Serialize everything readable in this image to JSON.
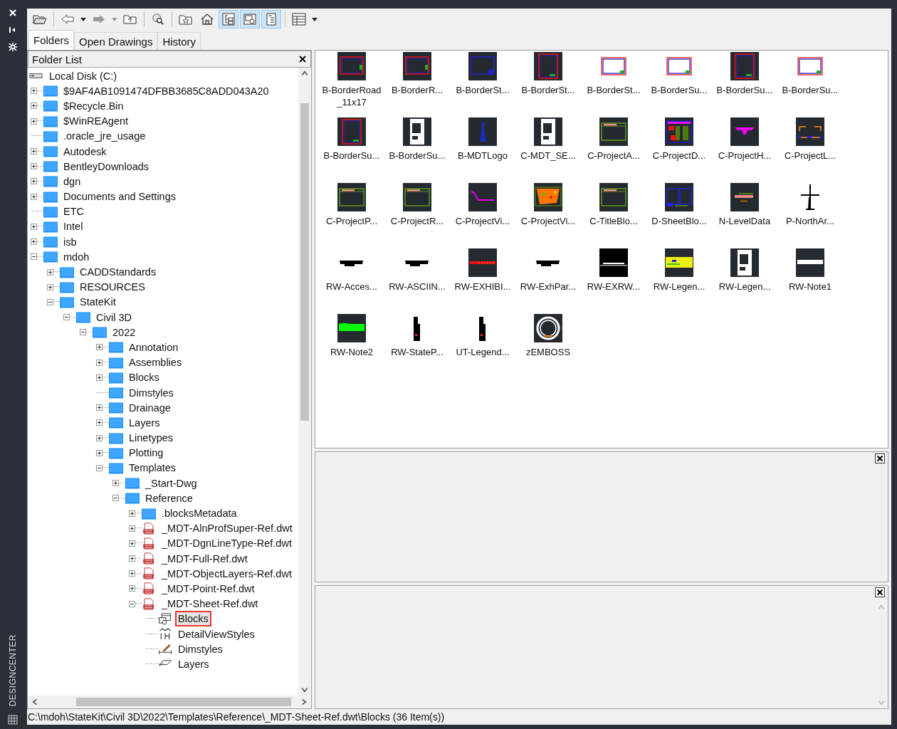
{
  "side_strip": {
    "title": "DESIGNCENTER"
  },
  "toolbar": [
    [
      {
        "kind": "load",
        "on": false
      }
    ],
    [
      {
        "kind": "back",
        "on": false
      },
      {
        "kind": "back-menu",
        "on": false
      },
      {
        "kind": "forward",
        "on": false
      },
      {
        "kind": "forward-menu",
        "on": false
      },
      {
        "kind": "up",
        "on": false
      }
    ],
    [
      {
        "kind": "search",
        "on": false
      }
    ],
    [
      {
        "kind": "favorites",
        "on": false
      },
      {
        "kind": "home",
        "on": false
      },
      {
        "kind": "tree-toggle",
        "on": true
      },
      {
        "kind": "preview",
        "on": true
      },
      {
        "kind": "description",
        "on": true
      }
    ],
    [
      {
        "kind": "views",
        "on": false
      },
      {
        "kind": "views-menu",
        "on": false
      }
    ]
  ],
  "tabs": [
    {
      "label": "Folders",
      "selected": true
    },
    {
      "label": "Open Drawings",
      "selected": false
    },
    {
      "label": "History",
      "selected": false
    }
  ],
  "folder_list": {
    "title": "Folder List"
  },
  "folder_tree": {
    "label": "Local Disk (C:)",
    "kind": "drive",
    "selected": false,
    "children": [
      {
        "label": "$9AF4AB1091474DFBB3685C8ADD043A20",
        "kind": "folder",
        "expanded": false,
        "selected": false
      },
      {
        "label": "$Recycle.Bin",
        "kind": "folder",
        "expanded": false,
        "selected": false
      },
      {
        "label": "$WinREAgent",
        "kind": "folder",
        "expanded": false,
        "selected": false
      },
      {
        "label": ".oracle_jre_usage",
        "kind": "folder",
        "selected": false
      },
      {
        "label": "Autodesk",
        "kind": "folder",
        "expanded": false,
        "selected": false
      },
      {
        "label": "BentleyDownloads",
        "kind": "folder",
        "expanded": false,
        "selected": false
      },
      {
        "label": "dgn",
        "kind": "folder",
        "expanded": false,
        "selected": false
      },
      {
        "label": "Documents and Settings",
        "kind": "folder",
        "expanded": false,
        "selected": false
      },
      {
        "label": "ETC",
        "kind": "folder",
        "selected": false
      },
      {
        "label": "Intel",
        "kind": "folder",
        "expanded": false,
        "selected": false
      },
      {
        "label": "isb",
        "kind": "folder",
        "expanded": false,
        "selected": false
      },
      {
        "label": "mdoh",
        "kind": "folder",
        "expanded": true,
        "selected": false,
        "children": [
          {
            "label": "CADDStandards",
            "kind": "folder",
            "expanded": false,
            "selected": false
          },
          {
            "label": "RESOURCES",
            "kind": "folder",
            "expanded": false,
            "selected": false
          },
          {
            "label": "StateKit",
            "kind": "folder",
            "expanded": true,
            "selected": false,
            "children": [
              {
                "label": "Civil 3D",
                "kind": "folder",
                "expanded": true,
                "selected": false,
                "children": [
                  {
                    "label": "2022",
                    "kind": "folder",
                    "expanded": true,
                    "selected": false,
                    "children": [
                      {
                        "label": "Annotation",
                        "kind": "folder",
                        "expanded": false,
                        "selected": false
                      },
                      {
                        "label": "Assemblies",
                        "kind": "folder",
                        "expanded": false,
                        "selected": false
                      },
                      {
                        "label": "Blocks",
                        "kind": "folder",
                        "expanded": false,
                        "selected": false
                      },
                      {
                        "label": "Dimstyles",
                        "kind": "folder",
                        "selected": false
                      },
                      {
                        "label": "Drainage",
                        "kind": "folder",
                        "expanded": false,
                        "selected": false
                      },
                      {
                        "label": "Layers",
                        "kind": "folder",
                        "expanded": false,
                        "selected": false
                      },
                      {
                        "label": "Linetypes",
                        "kind": "folder",
                        "expanded": false,
                        "selected": false
                      },
                      {
                        "label": "Plotting",
                        "kind": "folder",
                        "expanded": false,
                        "selected": false
                      },
                      {
                        "label": "Templates",
                        "kind": "folder",
                        "expanded": true,
                        "selected": false,
                        "children": [
                          {
                            "label": "_Start-Dwg",
                            "kind": "folder",
                            "expanded": false,
                            "selected": false
                          },
                          {
                            "label": "Reference",
                            "kind": "folder",
                            "expanded": true,
                            "selected": false,
                            "children": [
                              {
                                "label": ".blocksMetadata",
                                "kind": "folder",
                                "expanded": false,
                                "selected": false
                              },
                              {
                                "label": "_MDT-AlnProfSuper-Ref.dwt",
                                "kind": "template",
                                "expanded": false,
                                "selected": false
                              },
                              {
                                "label": "_MDT-DgnLineType-Ref.dwt",
                                "kind": "template",
                                "expanded": false,
                                "selected": false
                              },
                              {
                                "label": "_MDT-Full-Ref.dwt",
                                "kind": "template",
                                "expanded": false,
                                "selected": false
                              },
                              {
                                "label": "_MDT-ObjectLayers-Ref.dwt",
                                "kind": "template",
                                "expanded": false,
                                "selected": false
                              },
                              {
                                "label": "_MDT-Point-Ref.dwt",
                                "kind": "template",
                                "expanded": false,
                                "selected": false
                              },
                              {
                                "label": "_MDT-Sheet-Ref.dwt",
                                "kind": "template",
                                "expanded": true,
                                "selected": false,
                                "children": [
                                  {
                                    "label": "Blocks",
                                    "kind": "blocks",
                                    "selected": true
                                  },
                                  {
                                    "label": "DetailViewStyles",
                                    "kind": "detail-styles",
                                    "selected": false
                                  },
                                  {
                                    "label": "Dimstyles",
                                    "kind": "dimstyles",
                                    "selected": false
                                  },
                                  {
                                    "label": "Layers",
                                    "kind": "layers",
                                    "selected": false
                                  }
                                ]
                              }
                            ]
                          }
                        ]
                      }
                    ]
                  }
                ]
              }
            ]
          }
        ]
      }
    ]
  },
  "content": {
    "items": [
      {
        "label": "B-BorderRoad_11x17"
      },
      {
        "label": "B-BorderR..."
      },
      {
        "label": "B-BorderSt..."
      },
      {
        "label": "B-BorderSt..."
      },
      {
        "label": "B-BorderSt..."
      },
      {
        "label": "B-BorderSu..."
      },
      {
        "label": "B-BorderSu..."
      },
      {
        "label": "B-BorderSu..."
      },
      {
        "label": "B-BorderSu..."
      },
      {
        "label": "B-BorderSu..."
      },
      {
        "label": "B-MDTLogo"
      },
      {
        "label": "C-MDT_SE..."
      },
      {
        "label": "C-ProjectA..."
      },
      {
        "label": "C-ProjectD..."
      },
      {
        "label": "C-ProjectH..."
      },
      {
        "label": "C-ProjectL..."
      },
      {
        "label": "C-ProjectP..."
      },
      {
        "label": "C-ProjectR..."
      },
      {
        "label": "C-ProjectVi..."
      },
      {
        "label": "C-ProjectVi..."
      },
      {
        "label": "C-TitleBlo..."
      },
      {
        "label": "D-SheetBlo..."
      },
      {
        "label": "N-LevelData"
      },
      {
        "label": "P-NorthAr..."
      },
      {
        "label": "RW-Acces..."
      },
      {
        "label": "RW-ASCIIN..."
      },
      {
        "label": "RW-EXHIBI..."
      },
      {
        "label": "RW-ExhPar..."
      },
      {
        "label": "RW-EXRW..."
      },
      {
        "label": "RW-Legen..."
      },
      {
        "label": "RW-Legen..."
      },
      {
        "label": "RW-Note1"
      },
      {
        "label": "RW-Note2"
      },
      {
        "label": "RW-StateP..."
      },
      {
        "label": "UT-Legend..."
      },
      {
        "label": "zEMBOSS"
      }
    ]
  },
  "status_bar": {
    "path": "C:\\mdoh\\StateKit\\Civil 3D\\2022\\Templates\\Reference\\_MDT-Sheet-Ref.dwt\\Blocks (36 Item(s))"
  }
}
